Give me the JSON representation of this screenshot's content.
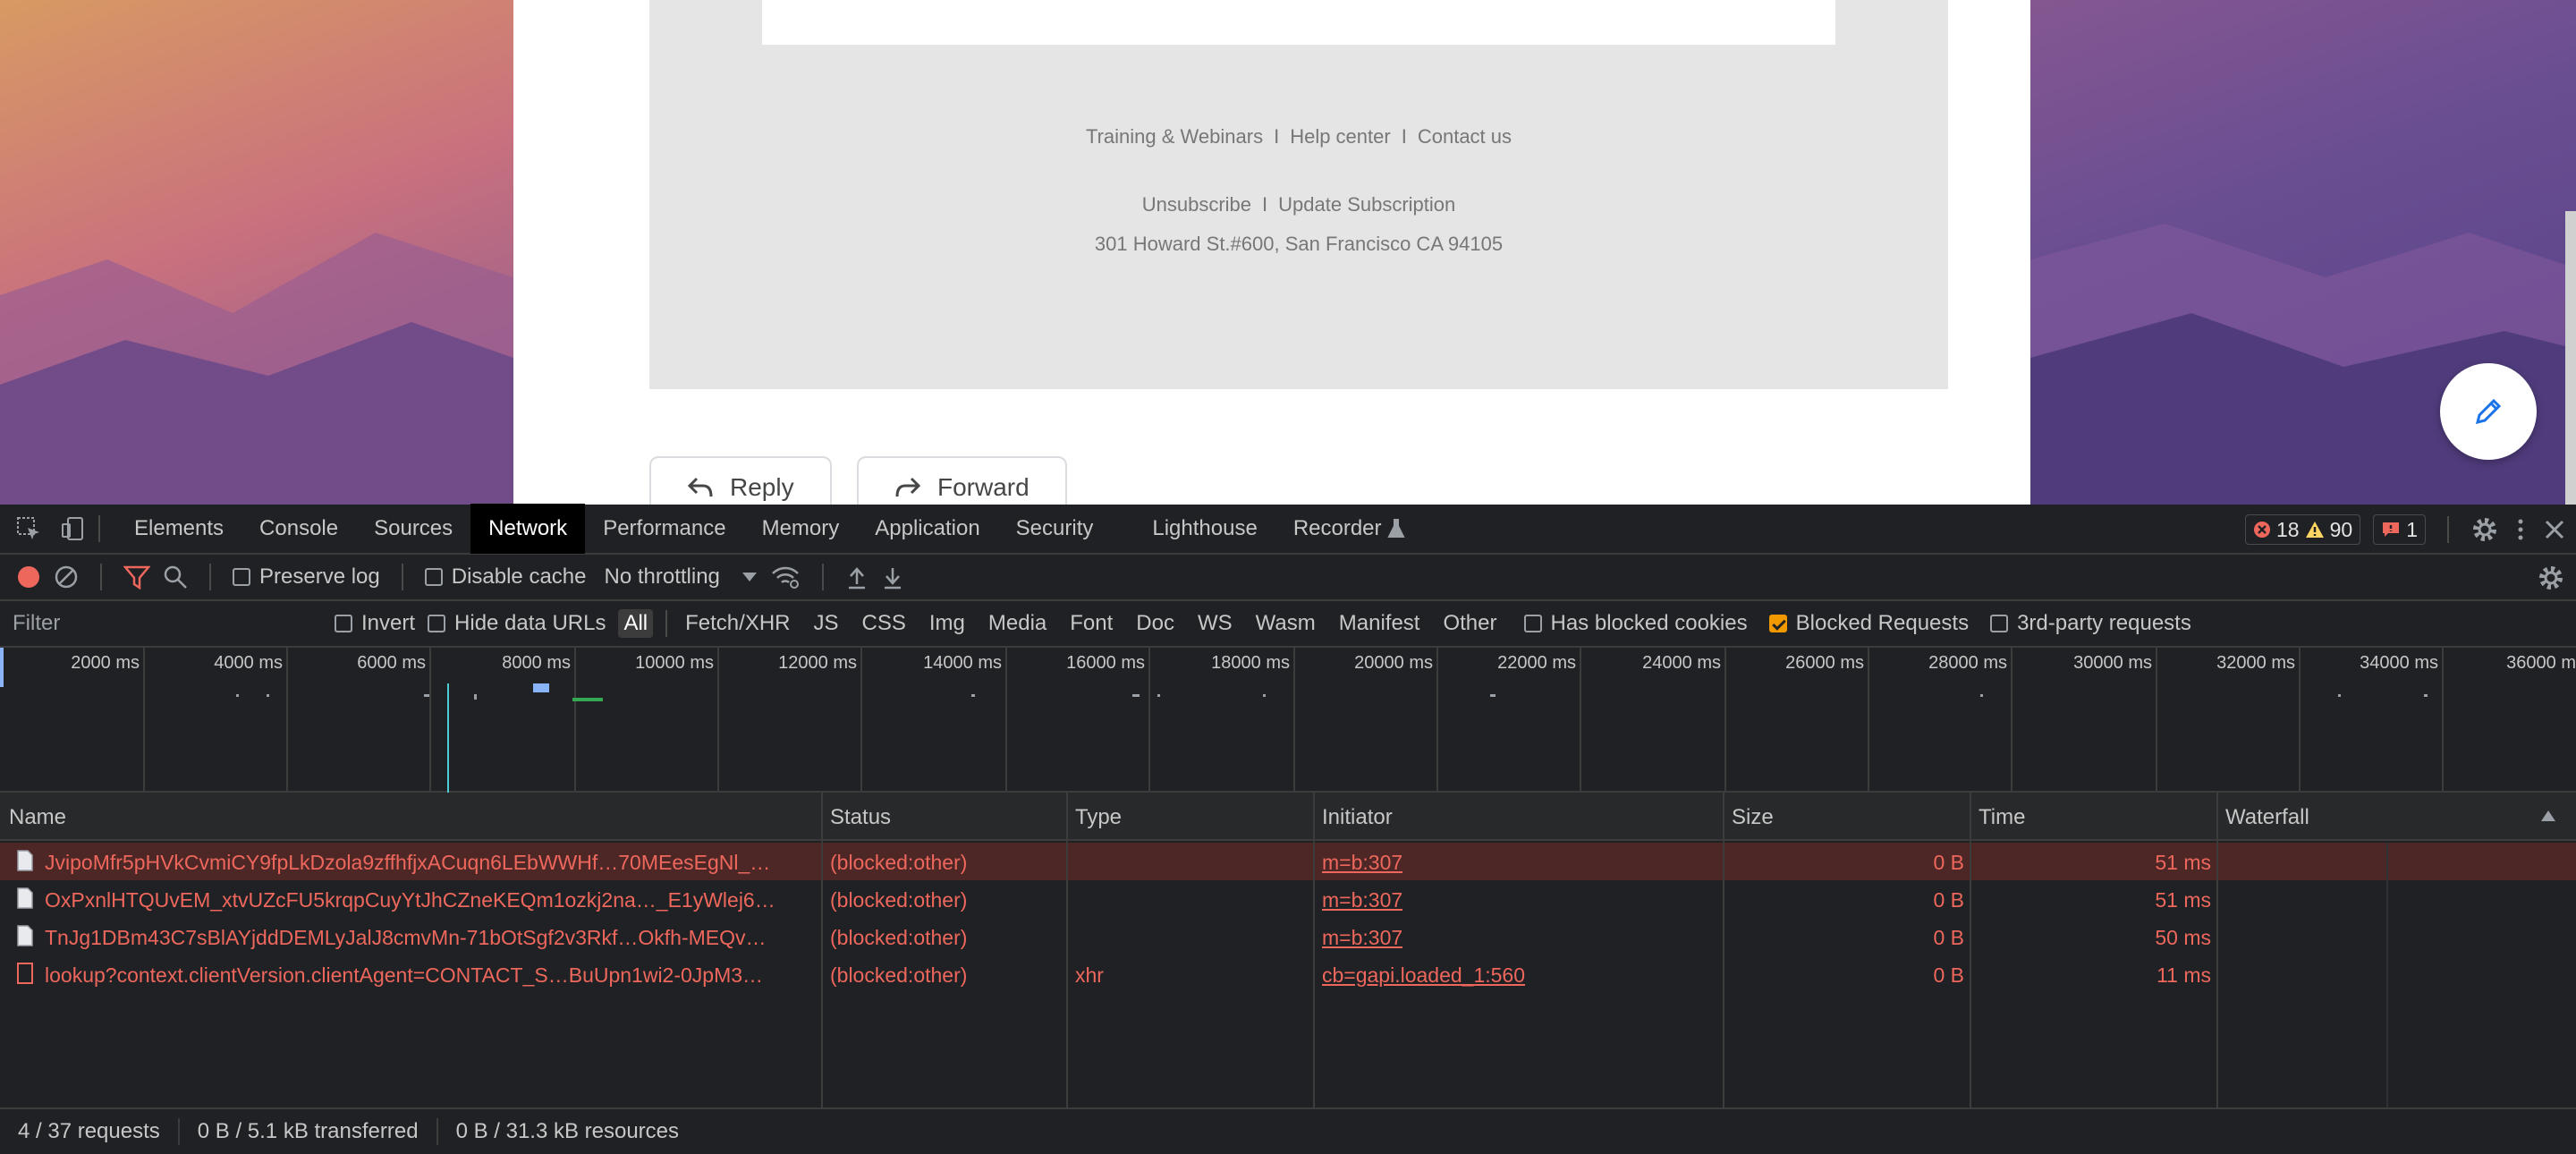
{
  "email": {
    "footer_links": [
      "Training & Webinars",
      "Help center",
      "Contact us"
    ],
    "manage_links": [
      "Unsubscribe",
      "Update Subscription"
    ],
    "address": "301 Howard St.#600, San Francisco CA 94105",
    "reply_label": "Reply",
    "forward_label": "Forward"
  },
  "devtools": {
    "tabs": [
      "Elements",
      "Console",
      "Sources",
      "Network",
      "Performance",
      "Memory",
      "Application",
      "Security",
      "Lighthouse",
      "Recorder"
    ],
    "active_tab": "Network",
    "errors_count": "18",
    "warnings_count": "90",
    "issues_count": "1",
    "toolbar": {
      "preserve_log": "Preserve log",
      "disable_cache": "Disable cache",
      "throttling": "No throttling"
    },
    "filter": {
      "placeholder": "Filter",
      "invert": "Invert",
      "hide_data_urls": "Hide data URLs",
      "types": [
        "All",
        "Fetch/XHR",
        "JS",
        "CSS",
        "Img",
        "Media",
        "Font",
        "Doc",
        "WS",
        "Wasm",
        "Manifest",
        "Other"
      ],
      "has_blocked_cookies": "Has blocked cookies",
      "blocked_requests": "Blocked Requests",
      "third_party": "3rd-party requests"
    },
    "timeline_ticks": [
      "2000 ms",
      "4000 ms",
      "6000 ms",
      "8000 ms",
      "10000 ms",
      "12000 ms",
      "14000 ms",
      "16000 ms",
      "18000 ms",
      "20000 ms",
      "22000 ms",
      "24000 ms",
      "26000 ms",
      "28000 ms",
      "30000 ms",
      "32000 ms",
      "34000 ms",
      "36000 m"
    ],
    "columns": {
      "name": "Name",
      "status": "Status",
      "type": "Type",
      "initiator": "Initiator",
      "size": "Size",
      "time": "Time",
      "waterfall": "Waterfall"
    },
    "rows": [
      {
        "name": "JvipoMfr5pHVkCvmiCY9fpLkDzola9zffhfjxACuqn6LEbWWHf…70MEesEgNl_…",
        "status": "(blocked:other)",
        "type": "",
        "initiator": "m=b:307",
        "size": "0 B",
        "time": "51 ms"
      },
      {
        "name": "OxPxnlHTQUvEM_xtvUZcFU5krqpCuyYtJhCZneKEQm1ozkj2na…_E1yWlej6…",
        "status": "(blocked:other)",
        "type": "",
        "initiator": "m=b:307",
        "size": "0 B",
        "time": "51 ms"
      },
      {
        "name": "TnJg1DBm43C7sBlAYjddDEMLyJalJ8cmvMn-71bOtSgf2v3Rkf…Okfh-MEQv…",
        "status": "(blocked:other)",
        "type": "",
        "initiator": "m=b:307",
        "size": "0 B",
        "time": "50 ms"
      },
      {
        "name": "lookup?context.clientVersion.clientAgent=CONTACT_S…BuUpn1wi2-0JpM3…",
        "status": "(blocked:other)",
        "type": "xhr",
        "initiator": "cb=gapi.loaded_1:560",
        "size": "0 B",
        "time": "11 ms"
      }
    ],
    "status_bar": {
      "requests": "4 / 37 requests",
      "transferred": "0 B / 5.1 kB transferred",
      "resources": "0 B / 31.3 kB resources"
    }
  }
}
